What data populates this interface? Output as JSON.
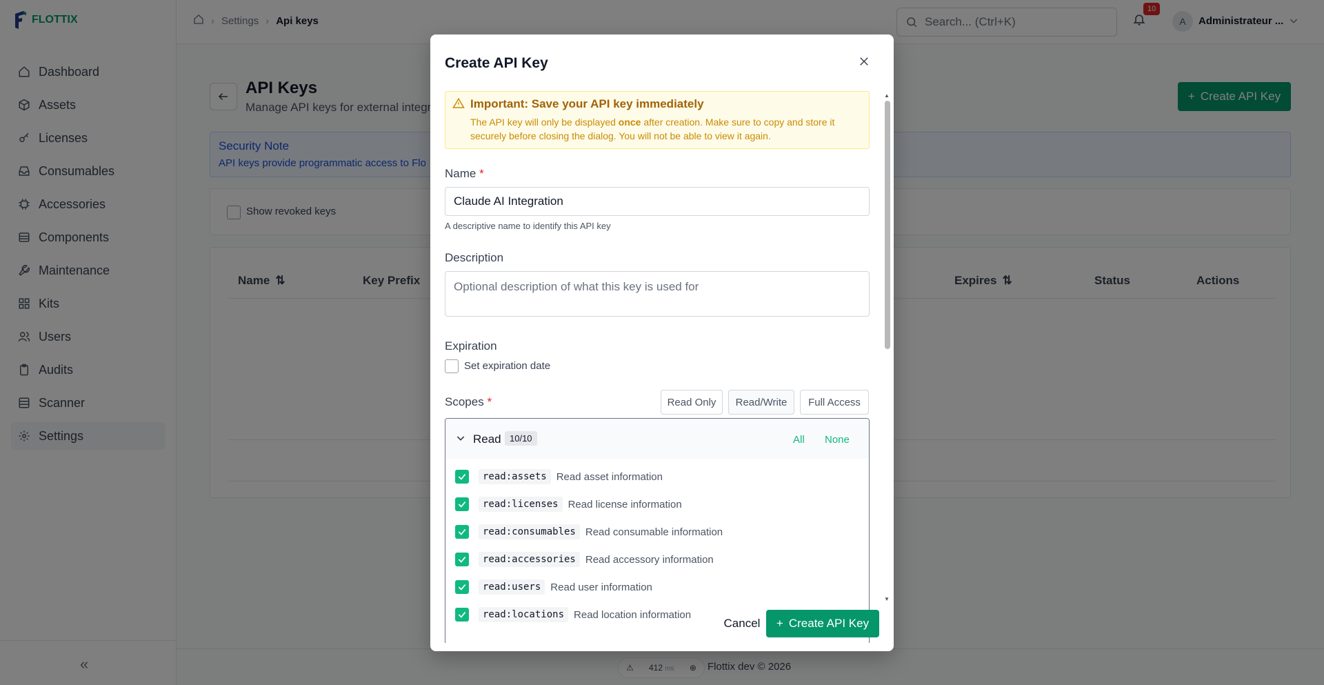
{
  "app": {
    "name": "FLOTTIX"
  },
  "sidebar": {
    "items": [
      {
        "label": "Dashboard",
        "icon": "home-icon"
      },
      {
        "label": "Assets",
        "icon": "box-icon"
      },
      {
        "label": "Licenses",
        "icon": "key-icon"
      },
      {
        "label": "Consumables",
        "icon": "inbox-icon"
      },
      {
        "label": "Accessories",
        "icon": "chip-icon"
      },
      {
        "label": "Components",
        "icon": "server-icon"
      },
      {
        "label": "Maintenance",
        "icon": "wrench-icon"
      },
      {
        "label": "Kits",
        "icon": "grid-icon"
      },
      {
        "label": "Users",
        "icon": "users-icon"
      },
      {
        "label": "Audits",
        "icon": "clipboard-icon"
      },
      {
        "label": "Scanner",
        "icon": "qr-icon"
      },
      {
        "label": "Settings",
        "icon": "gear-icon"
      }
    ],
    "active": "Settings",
    "collapse_label": "«"
  },
  "header": {
    "breadcrumb": {
      "home": "home-icon",
      "parent": "Settings",
      "current": "Api keys"
    },
    "search_placeholder": "Search... (Ctrl+K)",
    "notification_count": "10",
    "avatar_initial": "A",
    "user_name": "Administrateur ..."
  },
  "page": {
    "title": "API Keys",
    "subtitle": "Manage API keys for external integrations",
    "create_button": "Create API Key",
    "security_note": {
      "title": "Security Note",
      "text": "API keys provide programmatic access to Flottix"
    },
    "show_revoked_label": "Show revoked keys",
    "table_headers": [
      "Name",
      "Key Prefix",
      "Expires",
      "Status",
      "Actions"
    ]
  },
  "footer": {
    "text": "Flottix dev © 2026",
    "perf_ms": "412",
    "perf_unit": "ms"
  },
  "modal": {
    "title": "Create API Key",
    "warning": {
      "title": "Important: Save your API key immediately",
      "text_before": "The API key will only be displayed ",
      "text_bold": "once",
      "text_after": " after creation. Make sure to copy and store it securely before closing the dialog. You will not be able to view it again."
    },
    "name_label": "Name",
    "name_value": "Claude AI Integration",
    "name_hint": "A descriptive name to identify this API key",
    "description_label": "Description",
    "description_placeholder": "Optional description of what this key is used for",
    "expiration_label": "Expiration",
    "expiration_checkbox": "Set expiration date",
    "scopes_label": "Scopes",
    "scope_presets": [
      "Read Only",
      "Read/Write",
      "Full Access"
    ],
    "scope_group": {
      "name": "Read",
      "count": "10/10",
      "all_label": "All",
      "none_label": "None",
      "scopes": [
        {
          "code": "read:assets",
          "desc": "Read asset information",
          "checked": true
        },
        {
          "code": "read:licenses",
          "desc": "Read license information",
          "checked": true
        },
        {
          "code": "read:consumables",
          "desc": "Read consumable information",
          "checked": true
        },
        {
          "code": "read:accessories",
          "desc": "Read accessory information",
          "checked": true
        },
        {
          "code": "read:users",
          "desc": "Read user information",
          "checked": true
        },
        {
          "code": "read:locations",
          "desc": "Read location information",
          "checked": true
        }
      ]
    },
    "cancel_label": "Cancel",
    "create_label": "Create API Key"
  },
  "colors": {
    "accent": "#059669",
    "warning": "#ca8a04",
    "danger": "#dc2626"
  }
}
